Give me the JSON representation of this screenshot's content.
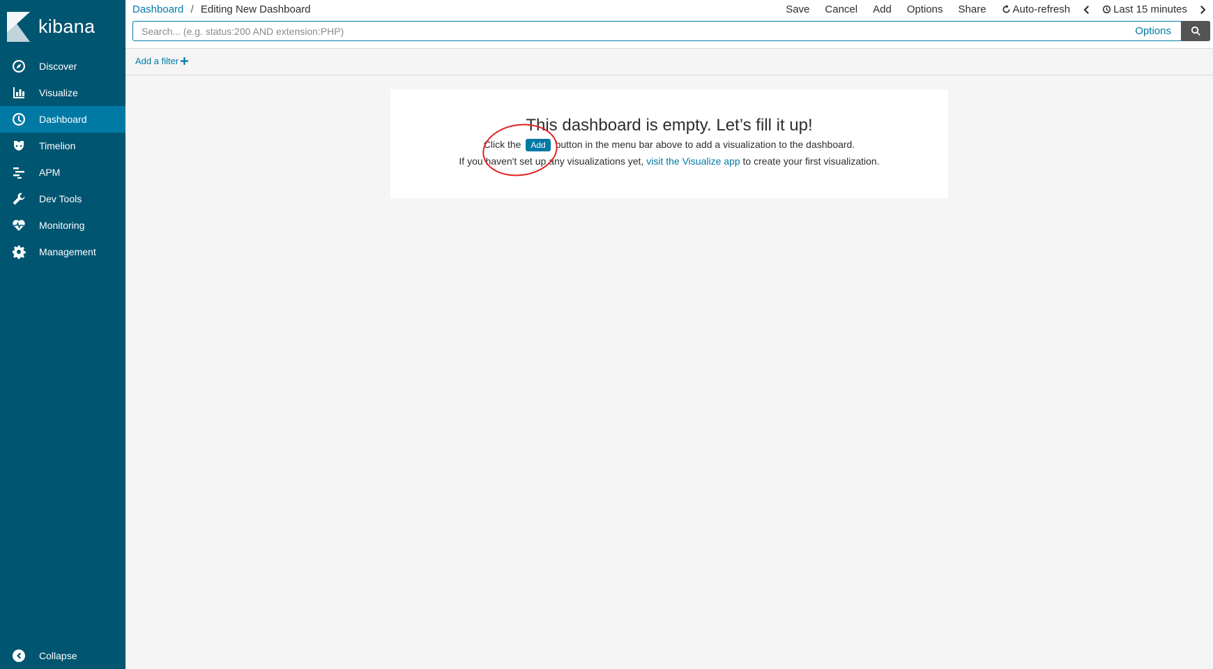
{
  "app": {
    "logo_text": "kibana"
  },
  "sidebar": {
    "items": [
      {
        "label": "Discover",
        "icon": "compass-icon",
        "active": false
      },
      {
        "label": "Visualize",
        "icon": "bar-chart-icon",
        "active": false
      },
      {
        "label": "Dashboard",
        "icon": "dashboard-icon",
        "active": true
      },
      {
        "label": "Timelion",
        "icon": "timelion-icon",
        "active": false
      },
      {
        "label": "APM",
        "icon": "apm-icon",
        "active": false
      },
      {
        "label": "Dev Tools",
        "icon": "wrench-icon",
        "active": false
      },
      {
        "label": "Monitoring",
        "icon": "heartbeat-icon",
        "active": false
      },
      {
        "label": "Management",
        "icon": "gear-icon",
        "active": false
      }
    ],
    "collapse_label": "Collapse"
  },
  "header": {
    "breadcrumb": {
      "link": "Dashboard",
      "separator": "/",
      "current": "Editing New Dashboard"
    },
    "menu": {
      "save": "Save",
      "cancel": "Cancel",
      "add": "Add",
      "options": "Options",
      "share": "Share",
      "auto_refresh": "Auto-refresh",
      "time_range": "Last 15 minutes"
    }
  },
  "search": {
    "placeholder": "Search... (e.g. status:200 AND extension:PHP)",
    "value": "",
    "options_label": "Options"
  },
  "filter": {
    "add_label": "Add a filter"
  },
  "empty_state": {
    "title": "This dashboard is empty. Let’s fill it up!",
    "line1_before": "Click the",
    "line1_button": "Add",
    "line1_after": "button in the menu bar above to add a visualization to the dashboard.",
    "line2_before": "If you haven't set up any visualizations yet,",
    "line2_link": "visit the Visualize app",
    "line2_after": "to create your first visualization."
  },
  "colors": {
    "sidebar_bg": "#005571",
    "sidebar_active": "#0079a5",
    "link": "#0079a5",
    "annotation": "#e02020"
  }
}
